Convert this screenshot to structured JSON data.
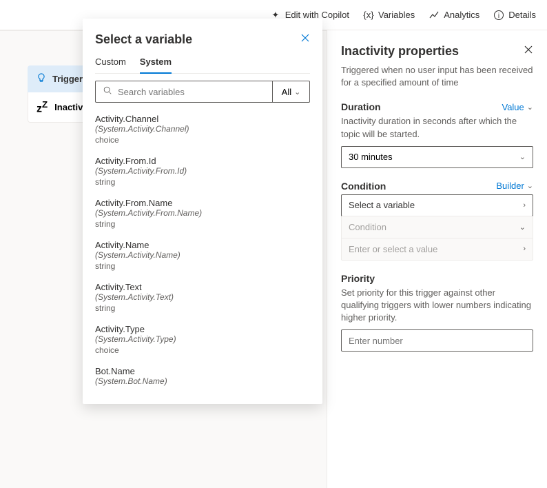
{
  "topbar": {
    "copilot": "Edit with Copilot",
    "variables": "Variables",
    "analytics": "Analytics",
    "details": "Details"
  },
  "canvas": {
    "trigger_label": "Trigger",
    "node_label": "Inactivity"
  },
  "popup": {
    "title": "Select a variable",
    "tabs": {
      "custom": "Custom",
      "system": "System"
    },
    "search_placeholder": "Search variables",
    "filter_label": "All",
    "variables": [
      {
        "name": "Activity.Channel",
        "path": "(System.Activity.Channel)",
        "type": "choice"
      },
      {
        "name": "Activity.From.Id",
        "path": "(System.Activity.From.Id)",
        "type": "string"
      },
      {
        "name": "Activity.From.Name",
        "path": "(System.Activity.From.Name)",
        "type": "string"
      },
      {
        "name": "Activity.Name",
        "path": "(System.Activity.Name)",
        "type": "string"
      },
      {
        "name": "Activity.Text",
        "path": "(System.Activity.Text)",
        "type": "string"
      },
      {
        "name": "Activity.Type",
        "path": "(System.Activity.Type)",
        "type": "choice"
      },
      {
        "name": "Bot.Name",
        "path": "(System.Bot.Name)",
        "type": ""
      }
    ]
  },
  "panel": {
    "title": "Inactivity properties",
    "subtitle": "Triggered when no user input has been received for a specified amount of time",
    "duration": {
      "label": "Duration",
      "link": "Value",
      "desc": "Inactivity duration in seconds after which the topic will be started.",
      "value": "30 minutes"
    },
    "condition": {
      "label": "Condition",
      "link": "Builder",
      "select_placeholder": "Select a variable",
      "cond_placeholder": "Condition",
      "value_placeholder": "Enter or select a value"
    },
    "priority": {
      "label": "Priority",
      "desc": "Set priority for this trigger against other qualifying triggers with lower numbers indicating higher priority.",
      "placeholder": "Enter number"
    }
  }
}
